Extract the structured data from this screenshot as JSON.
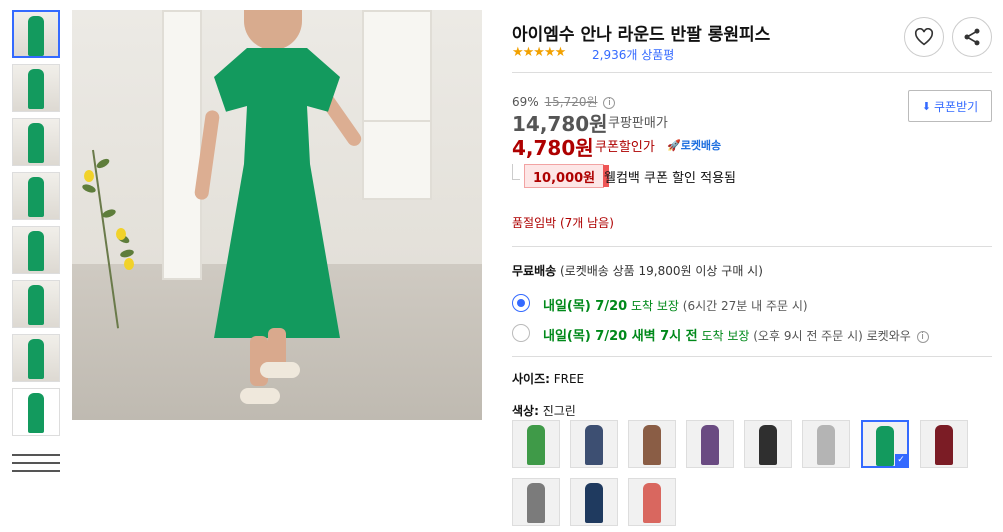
{
  "product": {
    "title": "아이엠수 안나 라운드 반팔 롱원피스",
    "rating_stars": "★★★★★",
    "review_count": "2,936개 상품평"
  },
  "actions": {
    "wishlist_icon": "heart-icon",
    "share_icon": "share-icon"
  },
  "price": {
    "discount_rate": "69%",
    "original_price": "15,720원",
    "sale_price": "14,780원",
    "sale_label": "쿠팡판매가",
    "coupon_price": "4,780원",
    "coupon_label": "쿠폰할인가",
    "rocket_label": "🚀로켓배송",
    "coupon_button": "쿠폰받기",
    "welcome_amount": "10,000원",
    "welcome_text": "웰컴백 쿠폰 할인 적용됨"
  },
  "stock": "품절임박 (7개 남음)",
  "shipping": {
    "title_bold": "무료배송",
    "title_rest": " (로켓배송 상품 19,800원 이상 구매 시)",
    "options": [
      {
        "date": "내일(목) 7/20",
        "guarantee": " 도착 보장",
        "note": " (6시간 27분 내 주문 시)",
        "extra": "",
        "selected": true
      },
      {
        "date": "내일(목) 7/20 새벽 7시 전",
        "guarantee": " 도착 보장",
        "note": " (오후 9시 전 주문 시)",
        "extra": "  로켓와우",
        "selected": false
      }
    ]
  },
  "size": {
    "label": "사이즈:",
    "value": " FREE"
  },
  "color": {
    "label": "색상:",
    "value": " 진그린"
  },
  "colors": {
    "swatches": [
      "#d7213d",
      "#2c5e97",
      "#7b5138",
      "#707070",
      "#1b1b1b",
      "#8d8d8d",
      "#6a1fa1",
      "#6d9a44"
    ],
    "options": [
      "#3f9a48",
      "#3d4f72",
      "#8a5d45",
      "#6a4b82",
      "#2f2f2f",
      "#b4b4b4",
      "#139a5e",
      "#7b1c25",
      "#7b7b7b",
      "#1f3a5f",
      "#d9675f"
    ],
    "selected_index": 6
  }
}
